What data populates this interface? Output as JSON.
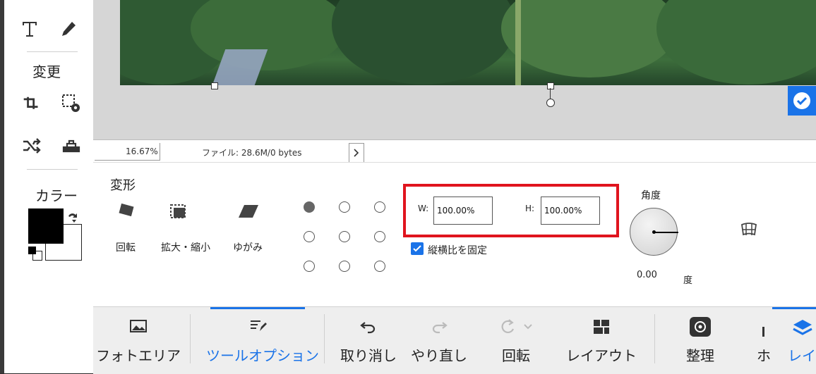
{
  "left_toolbar": {
    "section_change": "変更",
    "section_color": "カラー",
    "icons": [
      "text-tool-icon",
      "brush-tool-icon",
      "crop-tool-icon",
      "image-settings-icon",
      "shuffle-icon",
      "stamp-icon",
      "swap-colors-icon",
      "default-colors-icon"
    ],
    "colors": {
      "foreground": "#000000",
      "background": "#ffffff"
    }
  },
  "status_bar": {
    "zoom": "16.67%",
    "file_info": "ファイル: 28.6M/0 bytes"
  },
  "options": {
    "title": "変形",
    "tools": [
      {
        "label": "回転"
      },
      {
        "label": "拡大・縮小"
      },
      {
        "label": "ゆがみ"
      }
    ],
    "width_label": "W:",
    "width_value": "100.00%",
    "height_label": "H:",
    "height_value": "100.00%",
    "lock_ratio_label": "縦横比を固定",
    "lock_ratio_checked": true,
    "angle_label": "角度",
    "angle_value": "0.00",
    "angle_unit": "度",
    "accent_color": "#1a73e8",
    "highlight_color": "#e0141e"
  },
  "bottom_bar": {
    "items": [
      {
        "label": "フォトエリア",
        "icon": "image-icon"
      },
      {
        "label": "ツールオプション",
        "icon": "tool-options-icon",
        "active": true
      },
      {
        "label": "取り消し",
        "icon": "undo-icon"
      },
      {
        "label": "やり直し",
        "icon": "redo-icon",
        "disabled": true
      },
      {
        "label": "回転",
        "icon": "rotate-icon",
        "disabled": true
      },
      {
        "label": "レイアウト",
        "icon": "layout-icon"
      },
      {
        "label": "整理",
        "icon": "organize-icon"
      },
      {
        "label": "ホ",
        "icon": "home-icon"
      },
      {
        "label": "レイ",
        "icon": "layers-icon",
        "active": true
      }
    ]
  }
}
